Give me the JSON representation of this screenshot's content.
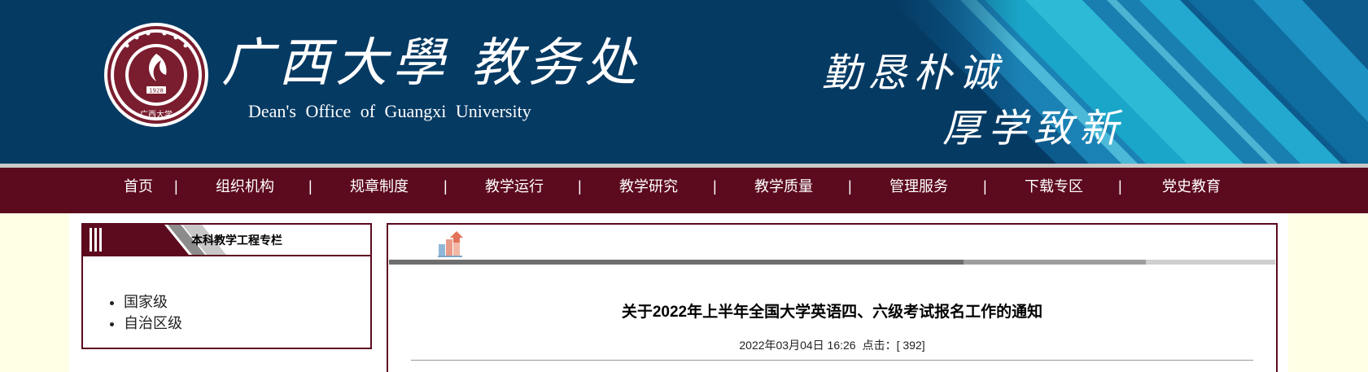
{
  "header": {
    "title_cn": "广西大學 教务处",
    "title_en": "Dean's Office of Guangxi University",
    "motto_line1": "勤恳朴诚",
    "motto_line2": "厚学致新",
    "emblem_year": "1928",
    "emblem_text": "广西大学",
    "colors": {
      "banner_bg": "#053a63",
      "accent_cyan": "#1aa6c8"
    }
  },
  "nav": {
    "items": [
      {
        "label": "首页"
      },
      {
        "label": "组织机构"
      },
      {
        "label": "规章制度"
      },
      {
        "label": "教学运行"
      },
      {
        "label": "教学研究"
      },
      {
        "label": "教学质量"
      },
      {
        "label": "管理服务"
      },
      {
        "label": "下载专区"
      },
      {
        "label": "党史教育"
      }
    ],
    "separator": "|",
    "colors": {
      "bg": "#5c0a1e",
      "text": "#ffffff"
    }
  },
  "sidebar": {
    "title": "本科教学工程专栏",
    "items": [
      {
        "label": "国家级"
      },
      {
        "label": "自治区级"
      }
    ]
  },
  "article": {
    "icon": "chart-icon",
    "title": "关于2022年上半年全国大学英语四、六级考试报名工作的通知",
    "date": "2022年03月04日 16:26",
    "clicks_label": "点击：[",
    "clicks_value": "392",
    "clicks_suffix": "]"
  }
}
